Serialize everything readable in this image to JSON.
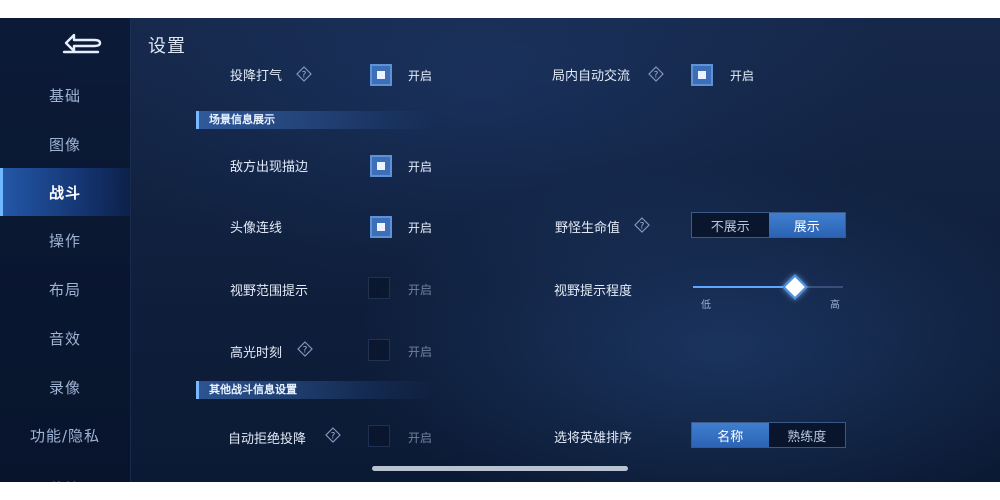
{
  "header": {
    "title": "设置"
  },
  "sidebar": {
    "items": [
      {
        "label": "基础"
      },
      {
        "label": "图像"
      },
      {
        "label": "战斗"
      },
      {
        "label": "操作"
      },
      {
        "label": "布局"
      },
      {
        "label": "音效"
      },
      {
        "label": "录像"
      },
      {
        "label": "功能/隐私"
      },
      {
        "label": "下载管理"
      }
    ],
    "active_index": 2
  },
  "settings": {
    "surrender_vote": {
      "label": "投降打气",
      "state": "开启"
    },
    "in_game_auto_chat": {
      "label": "局内自动交流",
      "state": "开启"
    },
    "section_scene_info": "场景信息展示",
    "enemy_outline": {
      "label": "敌方出现描边",
      "state": "开启"
    },
    "avatar_line": {
      "label": "头像连线",
      "state": "开启"
    },
    "vision_range_hint": {
      "label": "视野范围提示",
      "state": "开启"
    },
    "highlight_moment": {
      "label": "高光时刻",
      "state": "开启"
    },
    "section_other_combat": "其他战斗信息设置",
    "auto_reject_surrender": {
      "label": "自动拒绝投降",
      "state": "开启"
    },
    "monster_hp": {
      "label": "野怪生命值",
      "options": [
        "不展示",
        "展示"
      ],
      "selected": 1
    },
    "vision_hint_level": {
      "label": "视野提示程度",
      "min_label": "低",
      "max_label": "高",
      "value": 0.68
    },
    "hero_sort": {
      "label": "选将英雄排序",
      "options": [
        "名称",
        "熟练度"
      ],
      "selected": 0
    }
  },
  "colors": {
    "accent": "#3f7fd0",
    "active_nav": "#2c63b4",
    "background": "#0f1f3c"
  }
}
